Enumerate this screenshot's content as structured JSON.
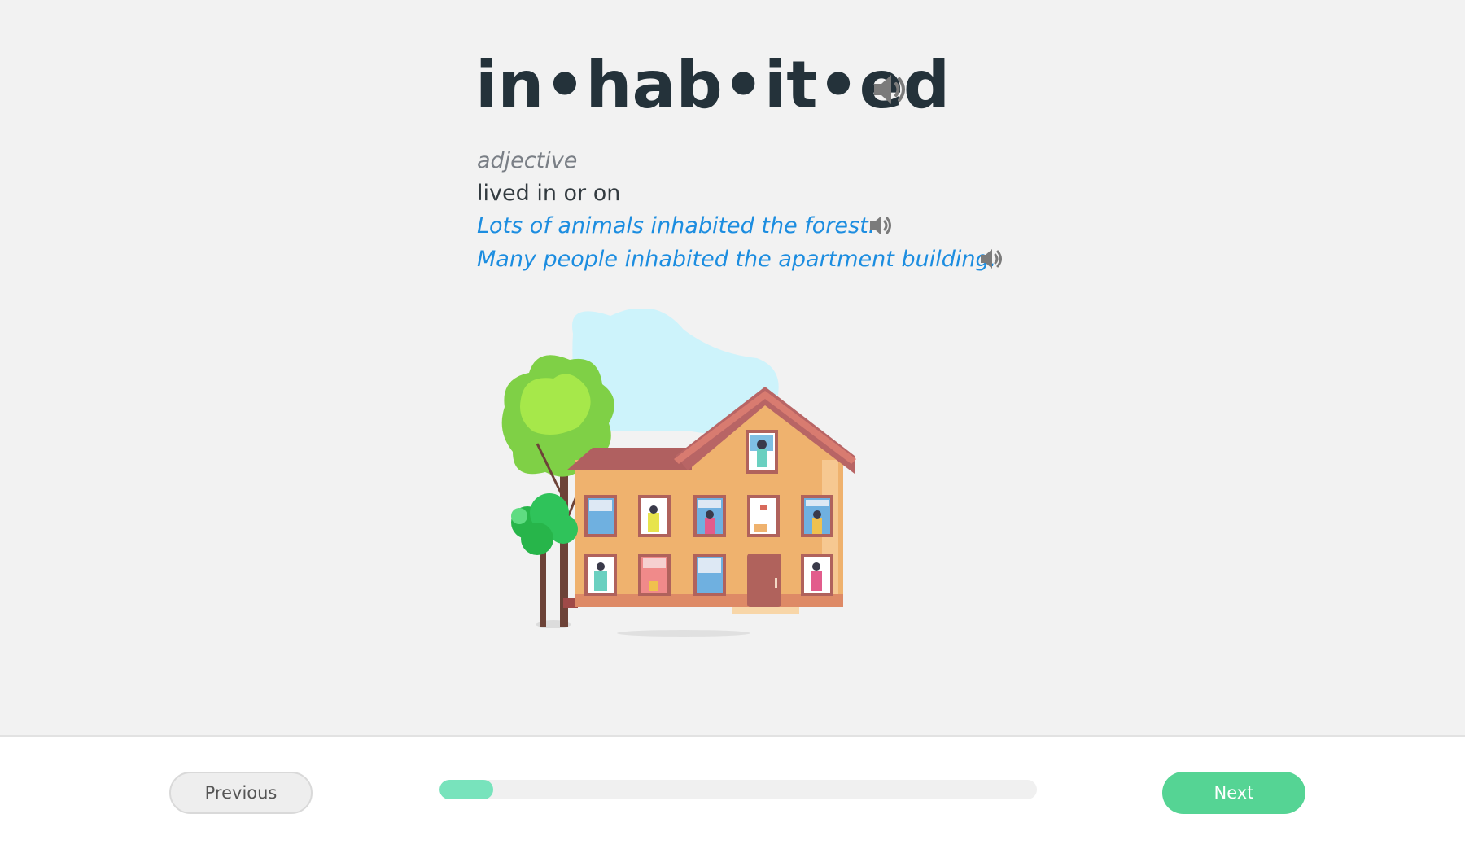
{
  "word": {
    "syllabified": "in•hab•it•ed",
    "audio_icon": "speaker-icon"
  },
  "entry": {
    "part_of_speech": "adjective",
    "definition": "lived in or on",
    "examples": [
      {
        "text": "Lots of animals inhabited the forest.",
        "audio_icon": "speaker-icon"
      },
      {
        "text": "Many people inhabited the apartment building.",
        "audio_icon": "speaker-icon"
      }
    ]
  },
  "footer": {
    "previous_label": "Previous",
    "next_label": "Next",
    "progress_fraction": 0.09
  },
  "colors": {
    "example_text": "#1c8de0",
    "next_button": "#55d494",
    "progress_fill": "#78e3bc",
    "word_text": "#24323a"
  }
}
